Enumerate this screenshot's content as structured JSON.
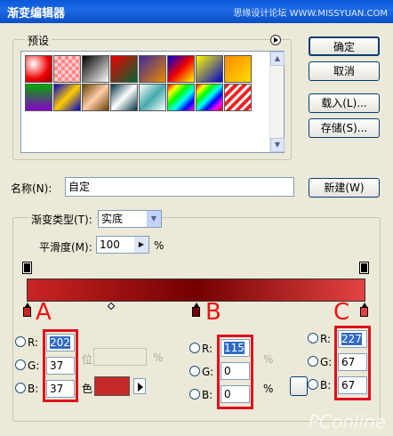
{
  "window": {
    "title": "渐变编辑器",
    "watermark": "思缘设计论坛 WWW.MISSYUAN.COM"
  },
  "presets": {
    "label": "预设"
  },
  "buttons": {
    "ok": "确定",
    "cancel": "取消",
    "load": "载入(L)...",
    "save": "存储(S)...",
    "new": "新建(W)"
  },
  "name": {
    "label": "名称(N):",
    "value": "自定"
  },
  "gradient_type": {
    "label": "渐变类型(T):",
    "value": "实底"
  },
  "smoothness": {
    "label": "平滑度(M):",
    "value": "100",
    "unit": "%"
  },
  "markers": {
    "a": "A",
    "b": "B",
    "c": "C"
  },
  "panel_a": {
    "r": "202",
    "g": "37",
    "b": "37",
    "r_label": "R:",
    "g_label": "G:",
    "b_label": "B:"
  },
  "panel_b": {
    "r": "115",
    "g": "0",
    "b": "0",
    "r_label": "R:",
    "g_label": "G:",
    "b_label": "B:"
  },
  "panel_c": {
    "r": "227",
    "g": "67",
    "b": "67",
    "r_label": "R:",
    "g_label": "G:",
    "b_label": "B:"
  },
  "partial": {
    "percent1": "%",
    "percent2": "%",
    "percent3": "%",
    "color_char": "色",
    "loc_char": "位"
  },
  "footer_watermark": "PConline",
  "colors": {
    "stop_a": "#ca2525",
    "stop_b": "#730000",
    "stop_c": "#e34343"
  }
}
